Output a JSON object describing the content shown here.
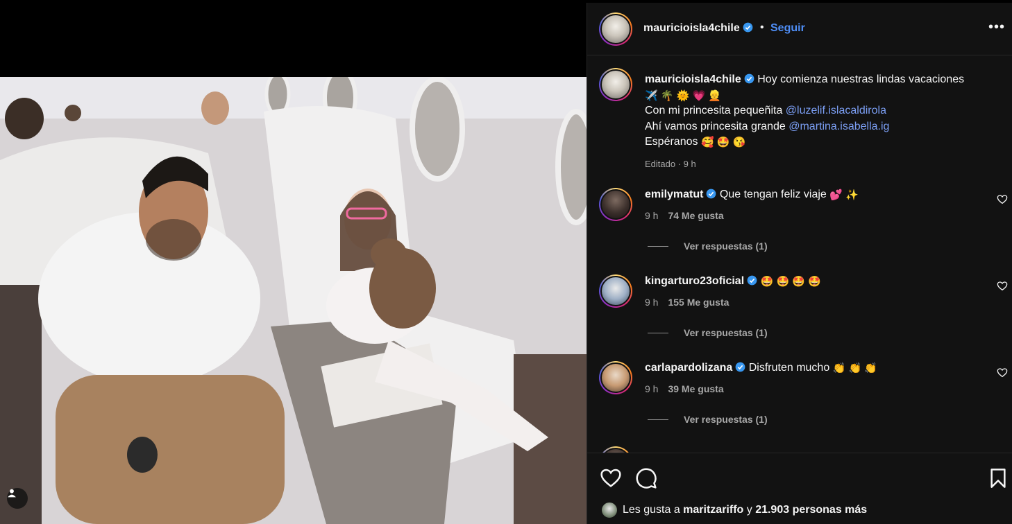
{
  "post": {
    "username": "mauricioisla4chile",
    "separator": "•",
    "follow_label": "Seguir",
    "more_label": "•••"
  },
  "caption": {
    "username": "mauricioisla4chile",
    "line1": "Hoy comienza nuestras lindas vacaciones",
    "emojis1": "✈️ 🌴 🌞 💗 👱",
    "line2_prefix": "Con mi princesita pequeñita ",
    "mention1": "@luzelif.islacaldirola",
    "line3_prefix": "Ahí vamos princesita grande ",
    "mention2": "@martina.isabella.ig",
    "line4": "Espéranos",
    "emojis4": "🥰 🤩 😘",
    "edited": "Editado",
    "time": "9 h"
  },
  "comments": [
    {
      "username": "emilymatut",
      "text": "Que tengan feliz viaje",
      "emojis": "💕 ✨",
      "time": "9 h",
      "likes": "74 Me gusta",
      "replies": "Ver respuestas (1)"
    },
    {
      "username": "kingarturo23oficial",
      "text": "",
      "emojis": "🤩 🤩 🤩 🤩",
      "time": "9 h",
      "likes": "155 Me gusta",
      "replies": "Ver respuestas (1)"
    },
    {
      "username": "carlapardolizana",
      "text": "Disfruten mucho",
      "emojis": "👏 👏 👏",
      "time": "9 h",
      "likes": "39 Me gusta",
      "replies": "Ver respuestas (1)"
    }
  ],
  "footer": {
    "likes_prefix": "Les gusta a ",
    "liked_by": "maritzariffo",
    "likes_mid": " y ",
    "likes_count": "21.903 personas más"
  },
  "colors": {
    "panel_bg": "#121212",
    "link": "#4f8ef7",
    "mention": "#7b9ef3",
    "muted": "#a8a8a8",
    "verified": "#3897f0"
  },
  "icons": [
    "heart-icon",
    "comment-icon",
    "bookmark-icon",
    "verified-icon",
    "more-icon",
    "user-tag-icon"
  ]
}
